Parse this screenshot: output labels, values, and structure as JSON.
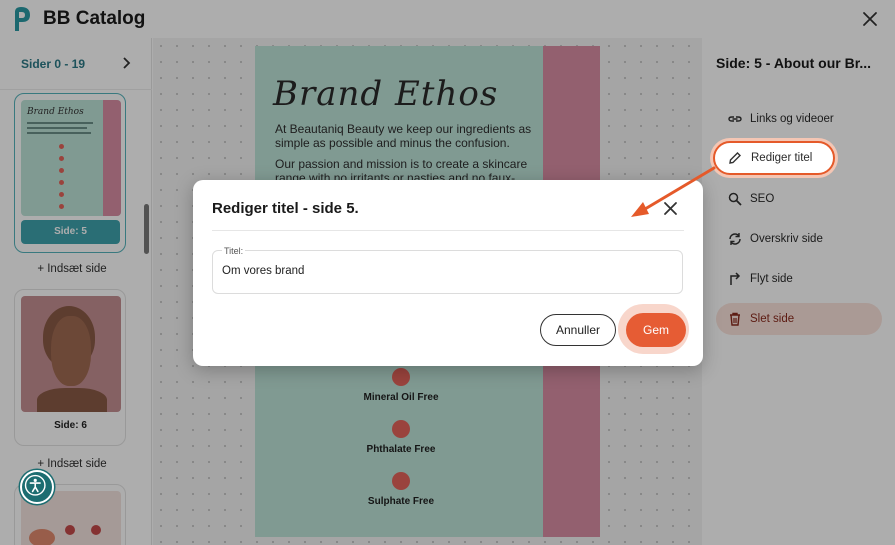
{
  "app": {
    "title": "BB Catalog"
  },
  "left_panel": {
    "range_label": "Sider 0 - 19",
    "thumbnails": [
      {
        "caption": "Side: 5",
        "active": true
      },
      {
        "caption": "Side: 6",
        "active": false
      }
    ],
    "insert_label": "+ Indsæt side"
  },
  "page_preview": {
    "heading": "Brand Ethos",
    "paragraph_1": "At Beautaniq Beauty we keep our ingredients as simple as possible and minus the confusion.",
    "paragraph_2": "Our passion and mission is to create a skincare range with no irritants or nasties and no faux-",
    "free_items": [
      "Mineral Oil Free",
      "Phthalate Free",
      "Sulphate Free"
    ]
  },
  "right_panel": {
    "title": "Side: 5 - About our Br...",
    "menu": [
      {
        "label": "Links og videoer",
        "icon": "link-icon"
      },
      {
        "label": "Rediger titel",
        "icon": "pencil-icon"
      },
      {
        "label": "SEO",
        "icon": "search-icon"
      },
      {
        "label": "Overskriv side",
        "icon": "refresh-icon"
      },
      {
        "label": "Flyt side",
        "icon": "move-arrow-icon"
      },
      {
        "label": "Slet side",
        "icon": "trash-icon"
      }
    ]
  },
  "modal": {
    "title": "Rediger titel - side 5.",
    "field_label": "Titel:",
    "field_value": "Om vores brand",
    "cancel_label": "Annuller",
    "save_label": "Gem"
  },
  "colors": {
    "accent_teal": "#3fa3ad",
    "accent_orange": "#e65c34",
    "danger_bg": "#fbe4dc",
    "page_mint": "#bde3d8",
    "page_pink": "#d98ea4"
  }
}
